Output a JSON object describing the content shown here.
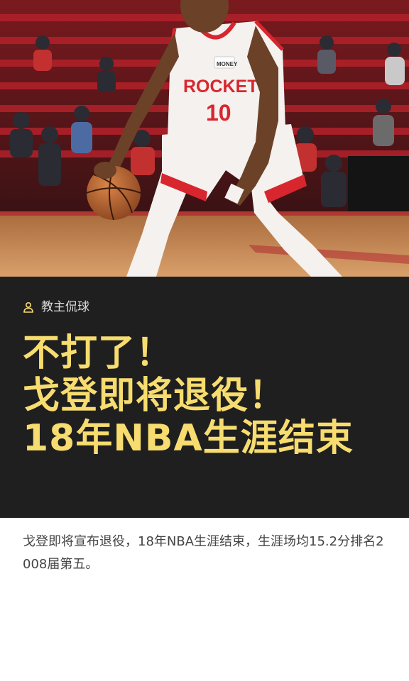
{
  "hero": {
    "photo_subject": "basketball-player-dribbling",
    "jersey_team": "ROCKETS",
    "jersey_number": "10",
    "jersey_sponsor": "MONEY",
    "colors": {
      "jersey": "#f4f1ee",
      "trim": "#d8262f",
      "seats": "#b3212a",
      "floor": "#c98f5a"
    }
  },
  "card": {
    "author": {
      "icon": "user-icon",
      "name": "教主侃球"
    },
    "headline": {
      "line1": "不打了！",
      "line2": "戈登即将退役！",
      "line3": "18年NBA生涯结束"
    },
    "colors": {
      "background": "#1f1f1f",
      "headline": "#f7dc6f"
    }
  },
  "summary": "戈登即将宣布退役，18年NBA生涯结束，生涯场均15.2分排名2008届第五。"
}
